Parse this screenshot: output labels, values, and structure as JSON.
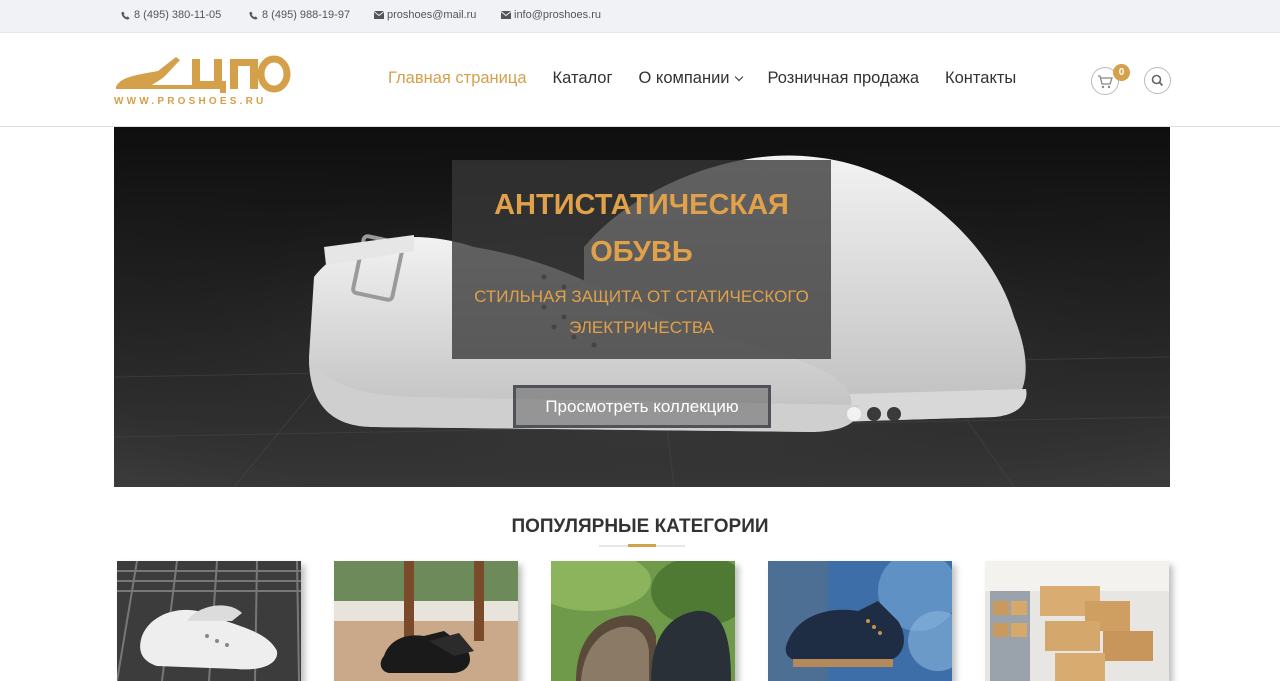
{
  "topbar": {
    "phone1": "8 (495) 380-11-05",
    "phone2": "8 (495) 988-19-97",
    "email1": "proshoes@mail.ru",
    "email2": "info@proshoes.ru"
  },
  "logo": {
    "text": "ЦПО",
    "url": "WWW.PROSHOES.RU"
  },
  "nav": {
    "items": [
      {
        "label": "Главная страница",
        "active": true
      },
      {
        "label": "Каталог"
      },
      {
        "label": "О компании",
        "dropdown": true
      },
      {
        "label": "Розничная продажа"
      },
      {
        "label": "Контакты"
      }
    ],
    "cart_count": "0"
  },
  "hero": {
    "title_line1": "АНТИСТАТИЧЕСКАЯ",
    "title_line2": "ОБУВЬ",
    "subtitle_line1": "СТИЛЬНАЯ ЗАЩИТА ОТ СТАТИЧЕСКОГО",
    "subtitle_line2": "ЭЛЕКТРИЧЕСТВА",
    "cta": "Просмотреть коллекцию",
    "slides": 3,
    "active_slide": 1
  },
  "popular": {
    "title": "ПОПУЛЯРНЫЕ КАТЕГОРИИ"
  },
  "colors": {
    "accent": "#d4a04a",
    "topbar_bg": "#f0f2f6",
    "text": "#333333"
  }
}
